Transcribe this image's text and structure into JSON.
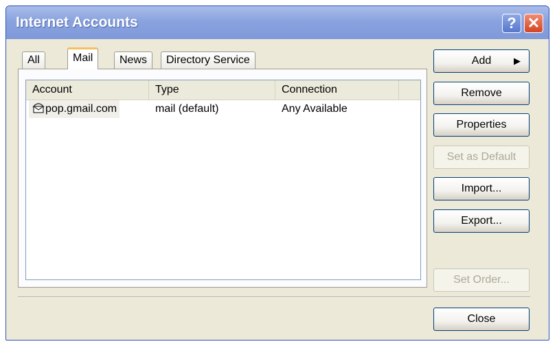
{
  "window": {
    "title": "Internet Accounts",
    "help_glyph": "?",
    "close_glyph": "✕"
  },
  "tabs": [
    {
      "label": "All"
    },
    {
      "label": "Mail",
      "active": true
    },
    {
      "label": "News"
    },
    {
      "label": "Directory Service"
    }
  ],
  "list": {
    "columns": [
      "Account",
      "Type",
      "Connection"
    ],
    "rows": [
      {
        "account": "pop.gmail.com",
        "type": "mail (default)",
        "connection": "Any Available",
        "icon": "mail-account-icon"
      }
    ]
  },
  "buttons": {
    "add": "Add",
    "add_arrow": "▶",
    "remove": "Remove",
    "properties": "Properties",
    "set_default": "Set as Default",
    "import": "Import...",
    "export": "Export...",
    "set_order": "Set Order...",
    "close": "Close"
  },
  "colors": {
    "titlebar": "#8aa3df",
    "window_bg": "#ece9d8",
    "active_tab_accent": "#f5c060",
    "button_border": "#003c74"
  }
}
